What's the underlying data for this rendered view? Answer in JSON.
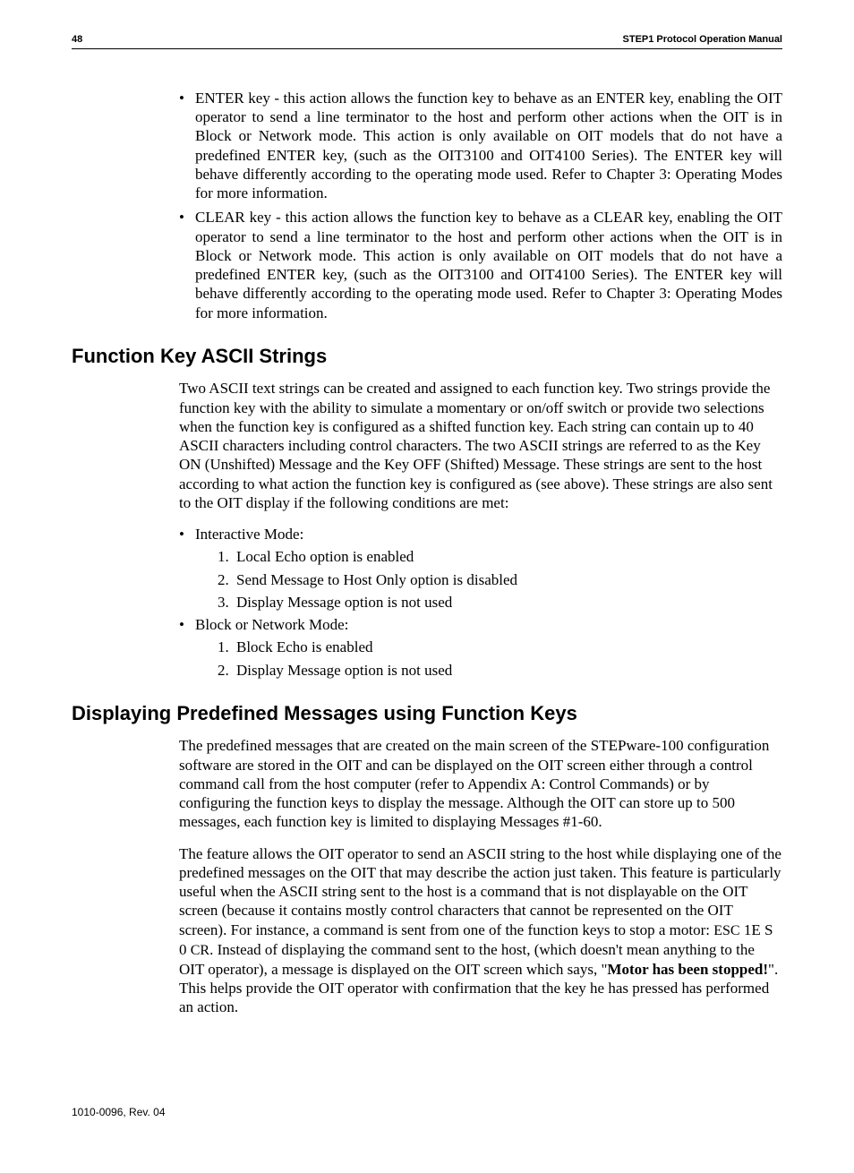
{
  "header": {
    "page_number": "48",
    "manual_title": "STEP1 Protocol Operation Manual"
  },
  "top_bullets": [
    "ENTER key - this action allows the function key to behave as an ENTER key, enabling the OIT operator to send a line terminator to the host and perform other actions when the OIT is in Block or Network mode.  This action is only available on OIT models that do not have a predefined ENTER key, (such as the OIT3100 and OIT4100 Series).  The ENTER key will behave differently according to the operating mode used. Refer to Chapter 3: Operating Modes for more information.",
    "CLEAR key - this action allows the function key to behave as a CLEAR key, enabling the OIT operator to send a line terminator to the host and perform other actions when the OIT is in Block or Network mode.  This action is only available on OIT models that do not have a predefined ENTER key, (such as the OIT3100 and OIT4100 Series).  The ENTER key will behave differently according to the operating mode used. Refer to Chapter 3: Operating Modes for more information."
  ],
  "section1": {
    "heading": "Function Key ASCII Strings",
    "intro": "Two ASCII text strings can be created and assigned to each function key.  Two strings provide the function key with the ability to simulate a momentary or on/off switch or provide two selections when the function key is configured as a shifted function key.  Each string can contain up to 40 ASCII characters including control characters.  The two ASCII strings are referred to as the Key ON (Unshifted) Message and the Key OFF (Shifted) Message.  These strings are sent to the host according to what action the function key is configured as (see above).  These strings are also sent to the OIT display if the following conditions are met:",
    "modes": [
      {
        "label": "Interactive Mode:",
        "items": [
          "Local Echo option is enabled",
          "Send Message to Host Only option is disabled",
          "Display Message option is not used"
        ]
      },
      {
        "label": "Block or Network Mode:",
        "items": [
          "Block Echo is enabled",
          "Display Message option is not used"
        ]
      }
    ]
  },
  "section2": {
    "heading": "Displaying Predefined Messages using Function Keys",
    "para1": "The predefined messages that are created on the main screen of the STEPware-100 configuration software are stored in the OIT and can be displayed on the OIT screen either through a control command call from the host computer (refer to Appendix A: Control Commands) or by configuring the function keys to display the message.  Although the OIT can store up to 500 messages, each function key is limited to displaying Messages #1-60.",
    "para2_pre": "The feature allows the OIT operator to send an ASCII string to the host while displaying one of the predefined messages on the OIT that may describe the action just taken.  This feature is particularly useful when the ASCII string sent to the host is a command that is not displayable on the OIT screen (because it contains mostly control characters that cannot be represented on the OIT screen). For instance, a command is sent from one of the function keys to stop a motor: ",
    "para2_cmd_esc": "ESC",
    "para2_cmd_mid": " 1E S 0 ",
    "para2_cmd_cr": "CR",
    "para2_after_cmd": ".  Instead of displaying the command sent to the host, (which doesn't mean anything to the OIT operator), a message is displayed on the OIT screen which says, \"",
    "para2_bold": "Motor has been stopped!",
    "para2_end": "\".  This helps provide the OIT operator with confirmation that the key he has pressed has performed an action."
  },
  "footer": {
    "doc_rev": "1010-0096, Rev. 04"
  }
}
